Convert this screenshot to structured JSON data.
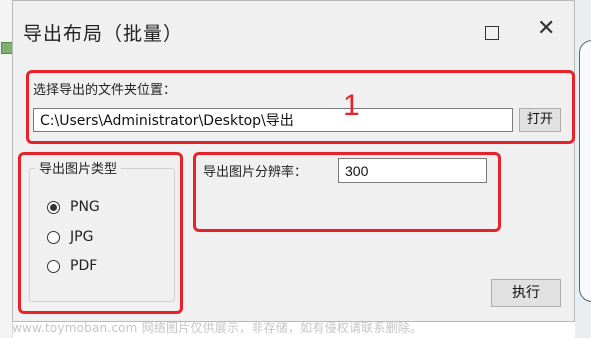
{
  "dialog": {
    "title": "导出布局（批量）",
    "close_glyph": "✕"
  },
  "path_section": {
    "label": "选择导出的文件夹位置：",
    "value": "C:\\Users\\Administrator\\Desktop\\导出",
    "open_button": "打开"
  },
  "image_type": {
    "group_title": "导出图片类型",
    "options": [
      {
        "label": "PNG",
        "checked": true
      },
      {
        "label": "JPG",
        "checked": false
      },
      {
        "label": "PDF",
        "checked": false
      }
    ]
  },
  "resolution": {
    "label": "导出图片分辨率：",
    "value": "300"
  },
  "run_button": "执行",
  "annotation": {
    "number": "1",
    "color": "#e8222b"
  },
  "watermark": "www.toymoban.com 网络图片仅供展示，非存储，如有侵权请联系删除。"
}
